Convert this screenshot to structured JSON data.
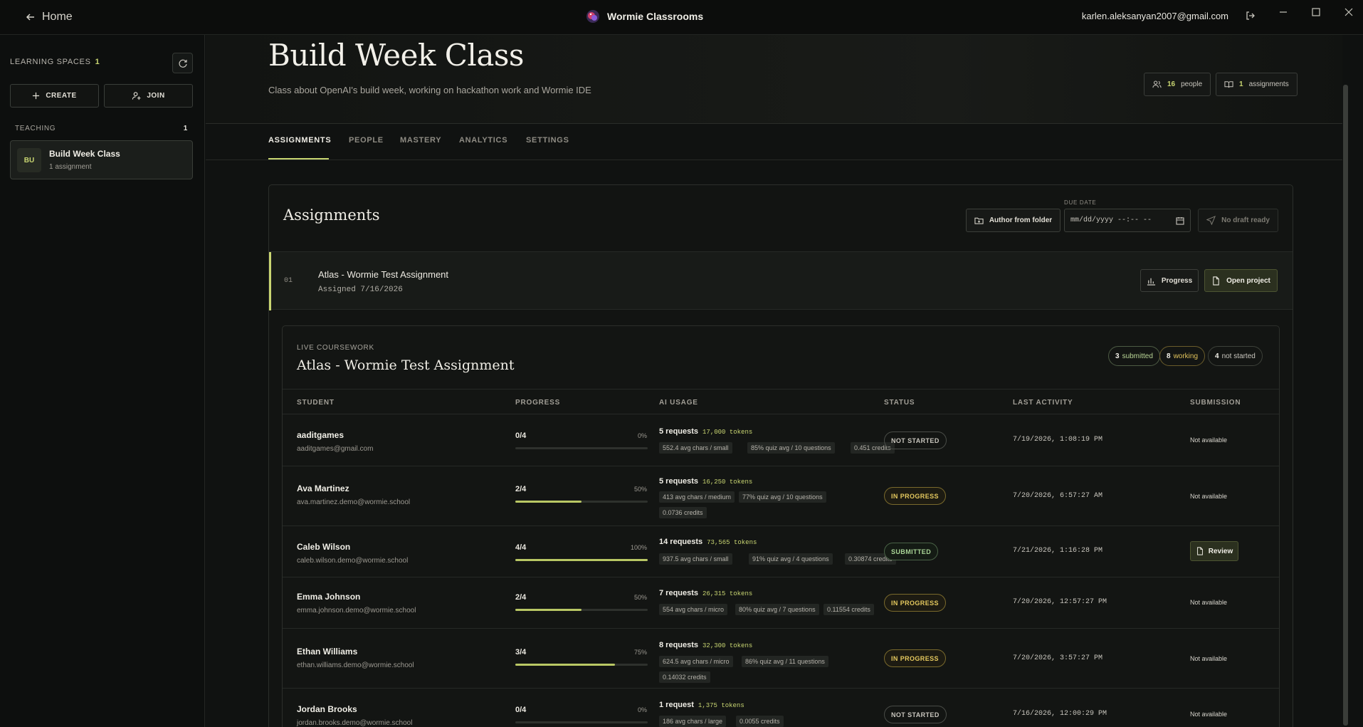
{
  "titlebar": {
    "home_label": "Home",
    "app_name": "Wormie Classrooms",
    "user_email": "karlen.aleksanyan2007@gmail.com"
  },
  "sidebar": {
    "learning_spaces_label": "LEARNING SPACES",
    "learning_spaces_count": "1",
    "create_label": "CREATE",
    "join_label": "JOIN",
    "teaching_label": "TEACHING",
    "teaching_count": "1",
    "classes": [
      {
        "avatar": "BU",
        "name": "Build Week Class",
        "sub": "1 assignment"
      }
    ]
  },
  "header": {
    "title": "Build Week Class",
    "description": "Class about OpenAI's build week, working on hackathon work and Wormie IDE",
    "people_count": "16",
    "people_label": "people",
    "assignments_count": "1",
    "assignments_label": "assignments"
  },
  "tabs": [
    "ASSIGNMENTS",
    "PEOPLE",
    "MASTERY",
    "ANALYTICS",
    "SETTINGS"
  ],
  "assignments": {
    "title": "Assignments",
    "author_label": "Author from folder",
    "due_label": "DUE DATE",
    "due_placeholder": "mm/dd/yyyy  --:-- --",
    "draft_label": "No draft ready",
    "items": [
      {
        "index": "01",
        "name": "Atlas - Wormie Test Assignment",
        "assigned": "Assigned 7/16/2026",
        "progress_label": "Progress",
        "open_label": "Open project"
      }
    ]
  },
  "coursework": {
    "kicker": "LIVE COURSEWORK",
    "title": "Atlas - Wormie Test Assignment",
    "submitted_count": "3",
    "submitted_label": "submitted",
    "working_count": "8",
    "working_label": "working",
    "not_started_count": "4",
    "not_started_label": "not started",
    "columns": [
      "STUDENT",
      "PROGRESS",
      "AI USAGE",
      "STATUS",
      "LAST ACTIVITY",
      "SUBMISSION"
    ],
    "rows": [
      {
        "name": "aaditgames",
        "email": "aaditgames@gmail.com",
        "progress": "0/4",
        "pct": "0%",
        "fraction": 0,
        "requests": "5 requests",
        "tokens": "17,000 tokens",
        "chips": [
          "552.4 avg chars / small",
          "85% quiz avg / 10 questions",
          "0.451 credits"
        ],
        "status": "NOT STARTED",
        "last": "7/19/2026, 1:08:19 PM",
        "submission": "Not available"
      },
      {
        "name": "Ava Martinez",
        "email": "ava.martinez.demo@wormie.school",
        "progress": "2/4",
        "pct": "50%",
        "fraction": 0.5,
        "requests": "5 requests",
        "tokens": "16,250 tokens",
        "chips": [
          "413 avg chars / medium",
          "77% quiz avg / 10 questions",
          "0.0736 credits"
        ],
        "status": "IN PROGRESS",
        "last": "7/20/2026, 6:57:27 AM",
        "submission": "Not available"
      },
      {
        "name": "Caleb Wilson",
        "email": "caleb.wilson.demo@wormie.school",
        "progress": "4/4",
        "pct": "100%",
        "fraction": 1,
        "requests": "14 requests",
        "tokens": "73,565 tokens",
        "chips": [
          "937.5 avg chars / small",
          "91% quiz avg / 4 questions",
          "0.30874 credits"
        ],
        "status": "SUBMITTED",
        "last": "7/21/2026, 1:16:28 PM",
        "submission": "Review"
      },
      {
        "name": "Emma Johnson",
        "email": "emma.johnson.demo@wormie.school",
        "progress": "2/4",
        "pct": "50%",
        "fraction": 0.5,
        "requests": "7 requests",
        "tokens": "26,315 tokens",
        "chips": [
          "554 avg chars / micro",
          "80% quiz avg / 7 questions",
          "0.11554 credits"
        ],
        "status": "IN PROGRESS",
        "last": "7/20/2026, 12:57:27 PM",
        "submission": "Not available"
      },
      {
        "name": "Ethan Williams",
        "email": "ethan.williams.demo@wormie.school",
        "progress": "3/4",
        "pct": "75%",
        "fraction": 0.75,
        "requests": "8 requests",
        "tokens": "32,300 tokens",
        "chips": [
          "624.5 avg chars / micro",
          "86% quiz avg / 11 questions",
          "0.14032 credits"
        ],
        "status": "IN PROGRESS",
        "last": "7/20/2026, 3:57:27 PM",
        "submission": "Not available"
      },
      {
        "name": "Jordan Brooks",
        "email": "jordan.brooks.demo@wormie.school",
        "progress": "0/4",
        "pct": "0%",
        "fraction": 0,
        "requests": "1 request",
        "tokens": "1,375 tokens",
        "chips": [
          "186 avg chars / large",
          "0.0055 credits"
        ],
        "status": "NOT STARTED",
        "last": "7/16/2026, 12:00:29 PM",
        "submission": "Not available"
      }
    ]
  }
}
